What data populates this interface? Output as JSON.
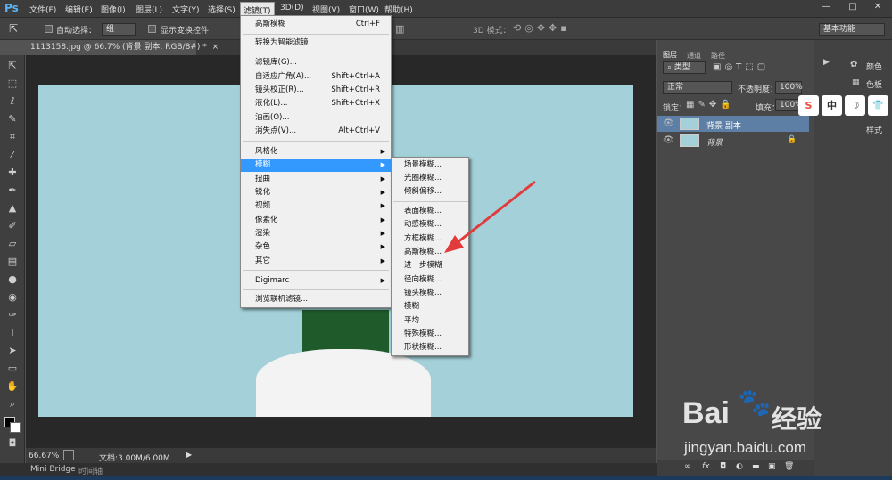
{
  "app": {
    "logo": "Ps"
  },
  "menubar": {
    "items": [
      "文件(F)",
      "编辑(E)",
      "图像(I)",
      "图层(L)",
      "文字(Y)",
      "选择(S)",
      "滤镜(T)",
      "3D(D)",
      "视图(V)",
      "窗口(W)",
      "帮助(H)"
    ],
    "active_index": 6,
    "window_controls": [
      "—",
      "□",
      "✕"
    ]
  },
  "options_bar": {
    "auto_select_label": "自动选择：",
    "auto_select_value": "组",
    "show_transform_label": "显示变换控件",
    "mode_3d_label": "3D 模式：",
    "workspace_value": "基本功能"
  },
  "document": {
    "tab_title": "1113158.jpg @ 66.7% (背景 副本, RGB/8#) *",
    "tab_close": "×"
  },
  "status": {
    "zoom": "66.67%",
    "doc_info": "文档:3.00M/6.00M"
  },
  "bottom_tabs": [
    "Mini Bridge",
    "时间轴"
  ],
  "filter_menu": {
    "items": [
      {
        "label": "高斯模糊",
        "shortcut": "Ctrl+F"
      },
      {
        "label": "转换为智能滤镜"
      },
      {
        "label": "滤镜库(G)..."
      },
      {
        "label": "自适应广角(A)...",
        "shortcut": "Shift+Ctrl+A"
      },
      {
        "label": "镜头校正(R)...",
        "shortcut": "Shift+Ctrl+R"
      },
      {
        "label": "液化(L)...",
        "shortcut": "Shift+Ctrl+X"
      },
      {
        "label": "油画(O)..."
      },
      {
        "label": "消失点(V)...",
        "shortcut": "Alt+Ctrl+V"
      },
      {
        "label": "风格化"
      },
      {
        "label": "模糊"
      },
      {
        "label": "扭曲"
      },
      {
        "label": "锐化"
      },
      {
        "label": "视频"
      },
      {
        "label": "像素化"
      },
      {
        "label": "渲染"
      },
      {
        "label": "杂色"
      },
      {
        "label": "其它"
      },
      {
        "label": "Digimarc"
      },
      {
        "label": "浏览联机滤镜..."
      }
    ],
    "highlighted": "模糊"
  },
  "blur_submenu": {
    "items": [
      "场景模糊...",
      "光圈模糊...",
      "倾斜偏移...",
      "表面模糊...",
      "动感模糊...",
      "方框模糊...",
      "高斯模糊...",
      "进一步模糊",
      "径向模糊...",
      "镜头模糊...",
      "模糊",
      "平均",
      "特殊模糊...",
      "形状模糊..."
    ]
  },
  "layers_panel": {
    "tabs": [
      "图层",
      "通道",
      "路径"
    ],
    "kind_filter": "类型",
    "blend_mode": "正常",
    "opacity_label": "不透明度：",
    "opacity_value": "100%",
    "lock_label": "锁定：",
    "fill_label": "填充：",
    "fill_value": "100%",
    "layers": [
      {
        "name": "背景 副本",
        "selected": true
      },
      {
        "name": "背景",
        "locked": true
      }
    ],
    "footer_icons": [
      "∞",
      "fx",
      "◘",
      "◐",
      "▬",
      "▣",
      "🗑"
    ]
  },
  "side_panels": [
    "颜色",
    "色板",
    "样式"
  ],
  "ime_toolbar": [
    "S",
    "中",
    "☽",
    "👕"
  ],
  "watermark": {
    "brand": "Bai",
    "brand2": "经验",
    "url": "jingyan.baidu.com"
  },
  "colors": {
    "highlight": "#3399ff",
    "canvas": "#a3d0d9",
    "arrow": "#e23b3b"
  }
}
